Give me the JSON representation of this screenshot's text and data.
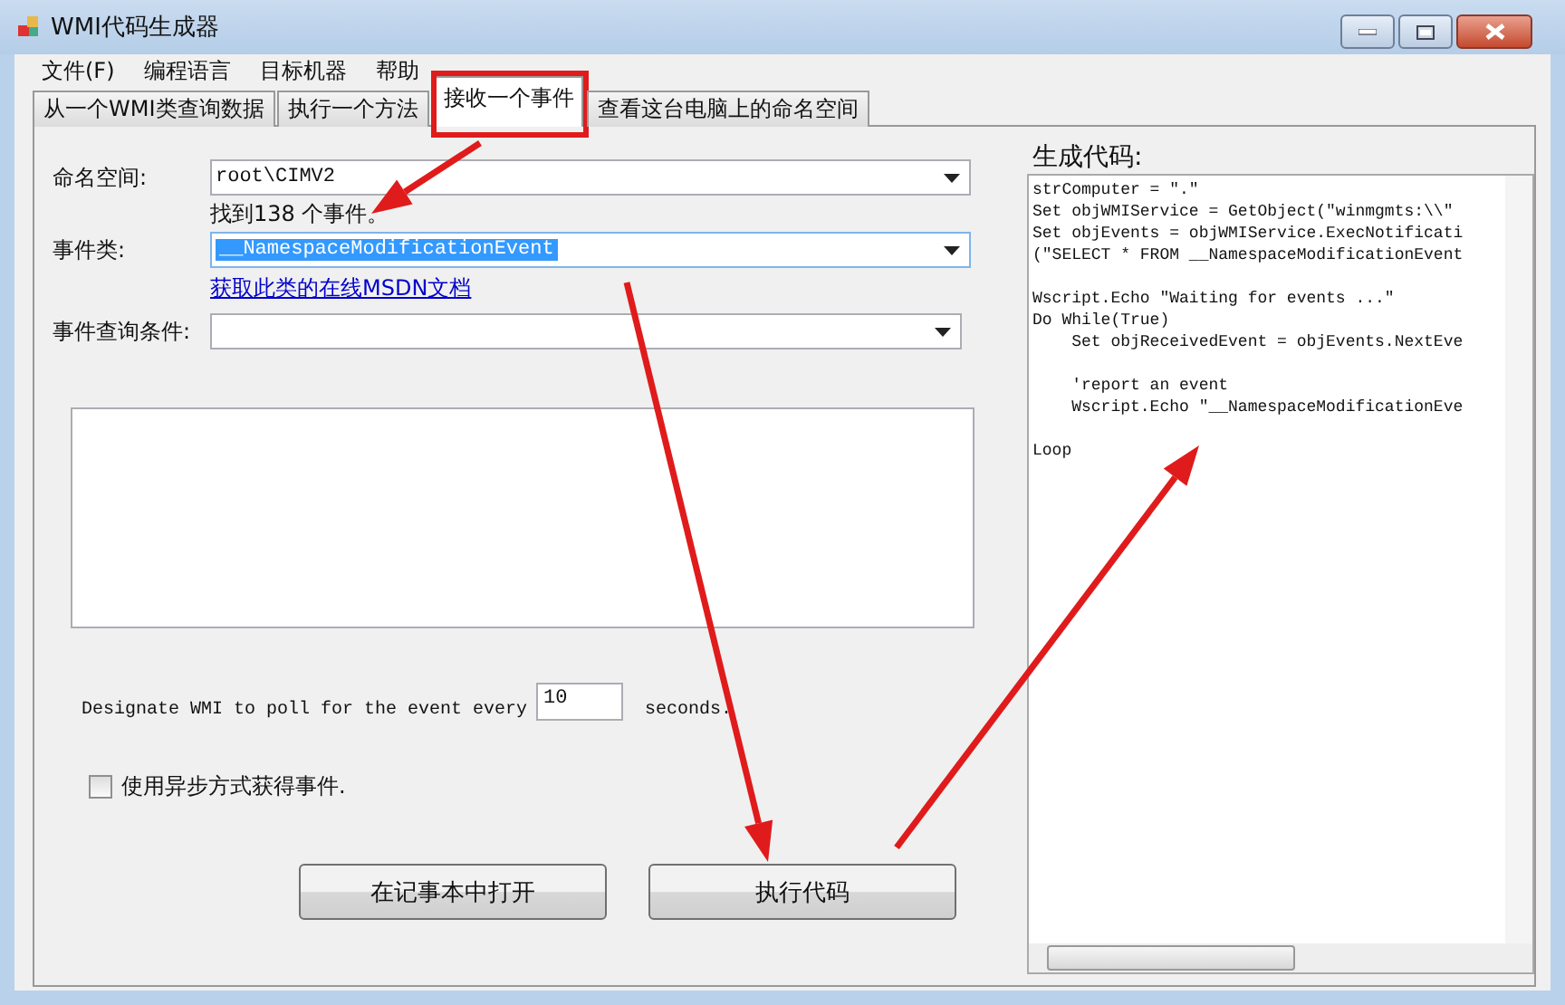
{
  "window": {
    "title": "WMI代码生成器"
  },
  "menu": [
    "文件(F)",
    "编程语言",
    "目标机器",
    "帮助"
  ],
  "tabs": [
    {
      "label": "从一个WMI类查询数据",
      "selected": false,
      "highlighted": false
    },
    {
      "label": "执行一个方法",
      "selected": false,
      "highlighted": false
    },
    {
      "label": "接收一个事件",
      "selected": true,
      "highlighted": true
    },
    {
      "label": "查看这台电脑上的命名空间",
      "selected": false,
      "highlighted": false
    }
  ],
  "form": {
    "namespace_label": "命名空间:",
    "namespace_value": "root\\CIMV2",
    "found_text": "找到138 个事件。",
    "event_class_label": "事件类:",
    "event_class_value": "__NamespaceModificationEvent",
    "msdn_link": "获取此类的在线MSDN文档",
    "condition_label": "事件查询条件:",
    "poll_text": "Designate WMI to poll for the event every",
    "poll_value": "10",
    "poll_unit": "seconds.",
    "async_checkbox": {
      "label": "使用异步方式获得事件.",
      "checked": false
    },
    "buttons": [
      "在记事本中打开",
      "执行代码"
    ]
  },
  "code_panel": {
    "title": "生成代码:",
    "blocks": [
      [
        "strComputer = \".\"",
        "Set objWMIService = GetObject(\"winmgmts:\\\\\"",
        "Set objEvents = objWMIService.ExecNotificati",
        "(\"SELECT * FROM __NamespaceModificationEvent"
      ],
      [
        "Wscript.Echo \"Waiting for events ...\"",
        "Do While(True)",
        "    Set objReceivedEvent = objEvents.NextEve"
      ],
      [
        "    'report an event",
        "    Wscript.Echo \"__NamespaceModificationEve"
      ],
      [
        "Loop"
      ]
    ]
  }
}
